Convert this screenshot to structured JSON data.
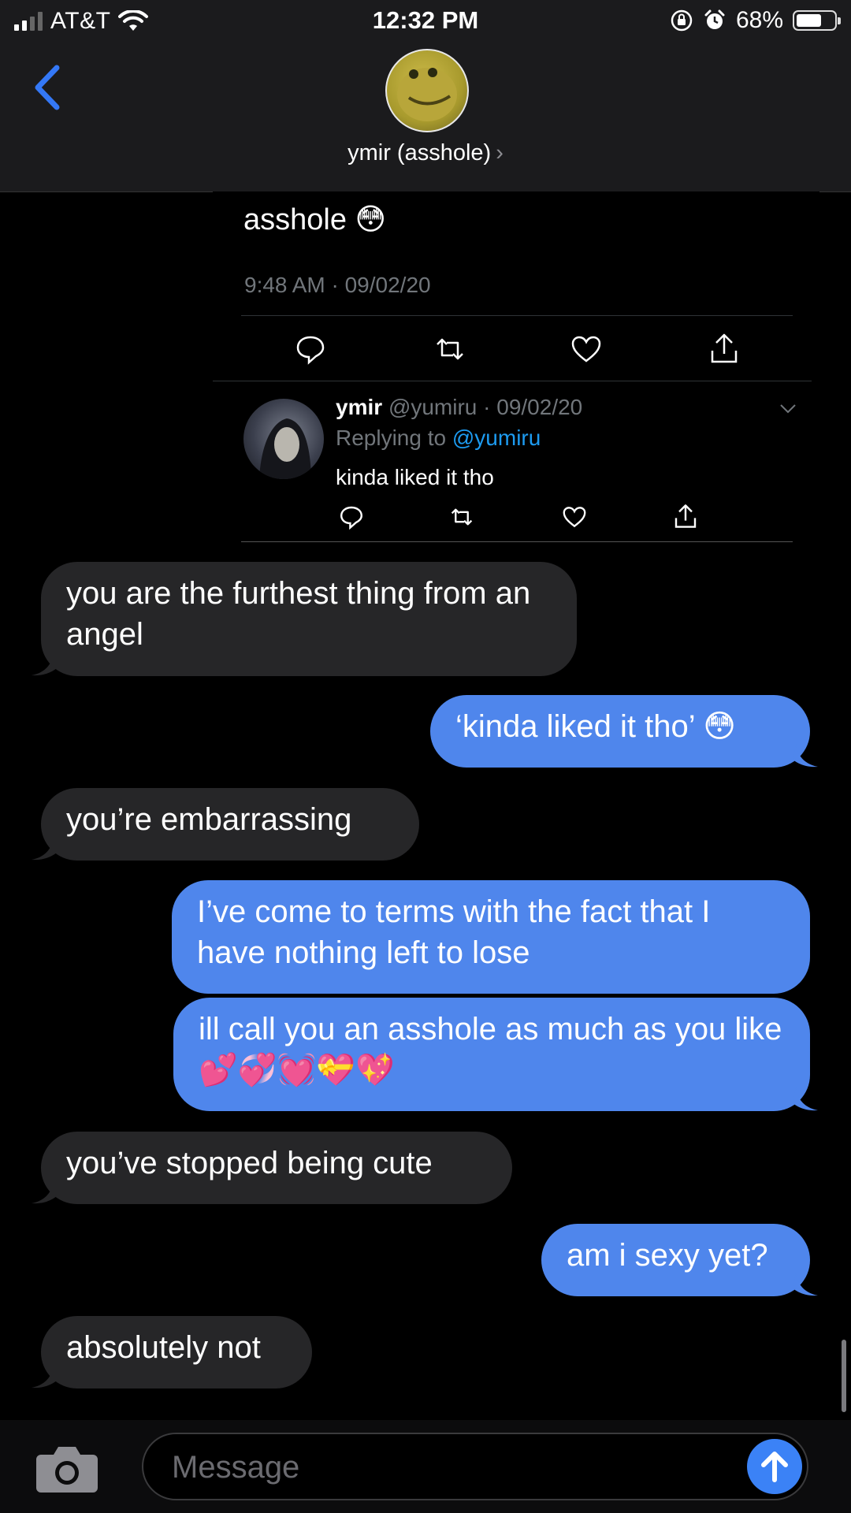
{
  "status_bar": {
    "carrier": "AT&T",
    "time": "12:32 PM",
    "battery_pct": "68%",
    "battery_level": 0.68
  },
  "header": {
    "contact_name": "ymir (asshole)",
    "chevron": "›"
  },
  "tweet": {
    "text": "asshole 😳",
    "meta": "9:48 AM · 09/02/20",
    "reply": {
      "name": "ymir",
      "handle_date": "@yumiru · 09/02/20",
      "replying_prefix": "Replying to ",
      "replying_handle": "@yumiru",
      "text": "kinda liked it tho"
    }
  },
  "messages": [
    {
      "side": "in",
      "text": "you are the furthest thing from an angel"
    },
    {
      "side": "out",
      "text": "‘kinda liked it tho’ 😳"
    },
    {
      "side": "in",
      "text": "you’re embarrassing"
    },
    {
      "side": "out",
      "text": "I’ve come to terms with the fact that I have nothing left to lose"
    },
    {
      "side": "out",
      "text": "ill call you an asshole as much as you like 💕💞💓💝💖"
    },
    {
      "side": "in",
      "text": "you’ve stopped being cute"
    },
    {
      "side": "out",
      "text": "am i sexy yet?"
    },
    {
      "side": "in",
      "text": "absolutely not"
    }
  ],
  "composer": {
    "placeholder": "Message"
  },
  "colors": {
    "outgoing_bubble": "#4f86ec",
    "incoming_bubble": "#262628",
    "ios_blue": "#3478f6",
    "twitter_link": "#1d9bf0"
  }
}
